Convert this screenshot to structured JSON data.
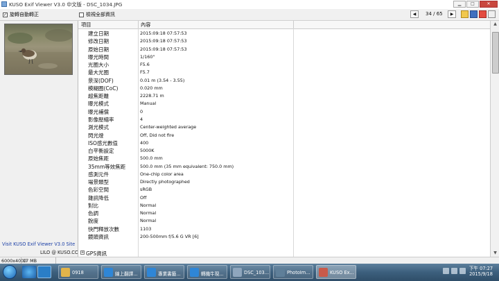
{
  "window": {
    "title": "KUSO Exif Viewer V3.0 中文版 - DSC_1034.JPG"
  },
  "toolbar": {
    "auto_rotate_label": "旋轉自動轉正",
    "auto_rotate_checked": "✓",
    "show_all_label": "檢視全部資訊",
    "counter": "34 / 65"
  },
  "left_panel": {
    "visit_text": "Visit KUSO Exif Viewer V3.0 Site",
    "lilo_text": "LILO @ KUSO.CC"
  },
  "table": {
    "columns": [
      "項目",
      "內容"
    ],
    "rows": [
      {
        "label": "建立日期",
        "value": "2015:09:18 07:57:53"
      },
      {
        "label": "修改日期",
        "value": "2015:09:18 07:57:53"
      },
      {
        "label": "原始日期",
        "value": "2015:09:18 07:57:53"
      },
      {
        "label": "曝光時間",
        "value": "1/160\""
      },
      {
        "label": "光圈大小",
        "value": "F5.6"
      },
      {
        "label": "最大光圈",
        "value": "F5.7"
      },
      {
        "label": "景深(DOF)",
        "value": "0.01 m (3.54 - 3.55)"
      },
      {
        "label": "模糊圈(CoC)",
        "value": "0.020 mm"
      },
      {
        "label": "超焦距離",
        "value": "2228.71 m"
      },
      {
        "label": "曝光模式",
        "value": "Manual"
      },
      {
        "label": "曝光補償",
        "value": "0"
      },
      {
        "label": "影像壓縮率",
        "value": "4"
      },
      {
        "label": "測光模式",
        "value": "Center-weighted average"
      },
      {
        "label": "閃光燈",
        "value": "Off, Did not fire"
      },
      {
        "label": "ISO感光數值",
        "value": "400"
      },
      {
        "label": "白平衡設定",
        "value": "5000K"
      },
      {
        "label": "原始焦距",
        "value": "500.0 mm"
      },
      {
        "label": "35mm等效焦距",
        "value": "500.0 mm (35 mm equivalent: 750.0 mm)"
      },
      {
        "label": "感測元件",
        "value": "One-chip color area"
      },
      {
        "label": "場景類型",
        "value": "Directly photographed"
      },
      {
        "label": "色彩空間",
        "value": "sRGB"
      },
      {
        "label": "雜訊降低",
        "value": "Off"
      },
      {
        "label": "對比",
        "value": "Normal"
      },
      {
        "label": "色調",
        "value": "Normal"
      },
      {
        "label": "銳度",
        "value": "Normal"
      },
      {
        "label": "快門釋放次數",
        "value": "1103"
      },
      {
        "label": "鏡頭資訊",
        "value": "200-500mm f/5.6 G VR [6]"
      }
    ],
    "group": {
      "label": "GPS資訊",
      "icon": "expand-icon"
    }
  },
  "status": {
    "dimensions": "6000x4000",
    "size": "17 MB"
  },
  "taskbar": {
    "items": [
      {
        "label": "0918",
        "color": "#e2b44a"
      },
      {
        "label": "線上翻譯...",
        "color": "#2f86d6"
      },
      {
        "label": "專業書籤...",
        "color": "#2f86d6"
      },
      {
        "label": "轉機牛現...",
        "color": "#2f86d6"
      },
      {
        "label": "DSC_103...",
        "color": "#8fa6bd"
      },
      {
        "label": "PhotoIm...",
        "color": "#5f7f99"
      },
      {
        "label": "KUSO Ex...",
        "color": "#c85a4a",
        "active": true
      }
    ],
    "time": "下午 07:27",
    "date": "2015/9/18"
  },
  "colors": {
    "link": "#1b3fa6",
    "taskbar": "#3c5f7d",
    "close": "#c9473e"
  }
}
